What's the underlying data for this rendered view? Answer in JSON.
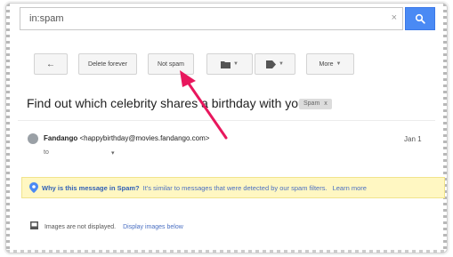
{
  "search": {
    "value": "in:spam",
    "clear_glyph": "×",
    "button_icon": "search-icon"
  },
  "toolbar": {
    "back_glyph": "←",
    "delete_forever": "Delete forever",
    "not_spam": "Not spam",
    "folder_icon": "folder-icon",
    "label_icon": "label-icon",
    "more": "More"
  },
  "message": {
    "subject": "Find out which celebrity shares a birthday with you...",
    "label": "Spam",
    "label_close": "x",
    "sender_name": "Fandango",
    "sender_email": "<happybirthday@movies.fandango.com>",
    "date": "Jan 1",
    "to": "to",
    "to_caret": "▾"
  },
  "spam_banner": {
    "question": "Why is this message in Spam?",
    "explanation": "It's similar to messages that were detected by our spam filters.",
    "learn_more": "Learn more"
  },
  "images": {
    "notice": "Images are not displayed.",
    "display_link": "Display images below"
  },
  "colors": {
    "search_button": "#4a8af4",
    "banner_bg": "#fff7c2",
    "arrow": "#e8175d",
    "link": "#4a6fc2"
  }
}
